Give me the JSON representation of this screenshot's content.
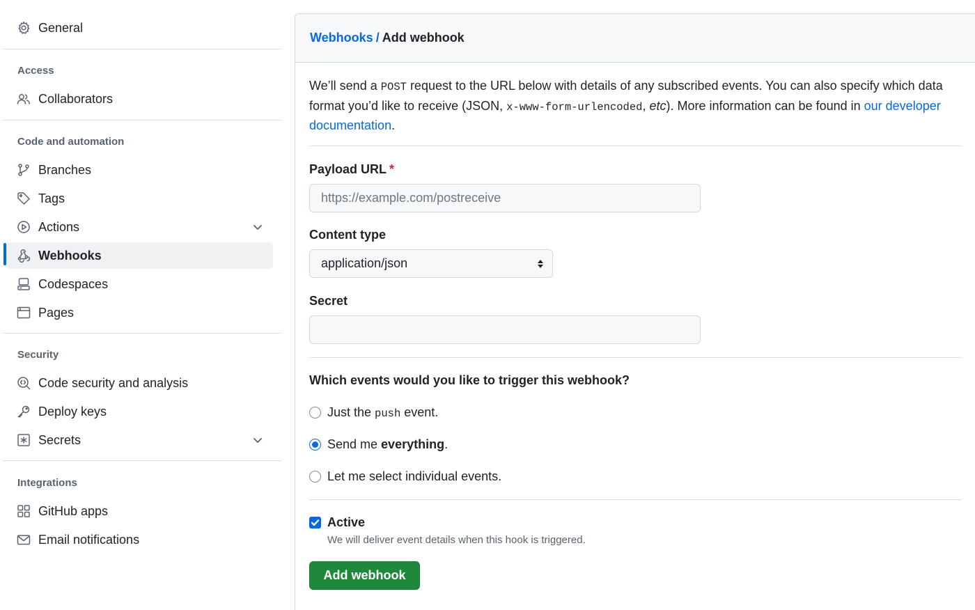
{
  "sidebar": {
    "general": {
      "label": "General",
      "icon": "gear-icon"
    },
    "sections": {
      "access": "Access",
      "code_automation": "Code and automation",
      "security": "Security",
      "integrations": "Integrations"
    },
    "items": {
      "collaborators": {
        "label": "Collaborators",
        "icon": "people-icon"
      },
      "branches": {
        "label": "Branches",
        "icon": "git-branch-icon"
      },
      "tags": {
        "label": "Tags",
        "icon": "tag-icon"
      },
      "actions": {
        "label": "Actions",
        "icon": "play-icon",
        "expandable": true
      },
      "webhooks": {
        "label": "Webhooks",
        "icon": "webhook-icon",
        "selected": true
      },
      "codespaces": {
        "label": "Codespaces",
        "icon": "codespaces-icon"
      },
      "pages": {
        "label": "Pages",
        "icon": "browser-icon"
      },
      "code_security": {
        "label": "Code security and analysis",
        "icon": "codescan-icon"
      },
      "deploy_keys": {
        "label": "Deploy keys",
        "icon": "key-icon"
      },
      "secrets": {
        "label": "Secrets",
        "icon": "key-asterisk-icon",
        "expandable": true
      },
      "github_apps": {
        "label": "GitHub apps",
        "icon": "apps-icon"
      },
      "email_notifications": {
        "label": "Email notifications",
        "icon": "mail-icon"
      }
    }
  },
  "breadcrumb": {
    "parent": "Webhooks",
    "separator": "/",
    "current": "Add webhook"
  },
  "intro": {
    "p1": "We’ll send a ",
    "code1": "POST",
    "p2": " request to the URL below with details of any subscribed events. You can also specify which data format you’d like to receive (JSON, ",
    "code2": "x-www-form-urlencoded",
    "p3": ", ",
    "em": "etc",
    "p4": "). More information can be found in ",
    "link": "our developer documentation",
    "p5": "."
  },
  "form": {
    "payload_url": {
      "label": "Payload URL",
      "required_mark": "*",
      "placeholder": "https://example.com/postreceive",
      "value": ""
    },
    "content_type": {
      "label": "Content type",
      "value": "application/json"
    },
    "secret": {
      "label": "Secret",
      "value": ""
    },
    "events": {
      "question": "Which events would you like to trigger this webhook?",
      "options": [
        {
          "pre": "Just the ",
          "code": "push",
          "post": " event.",
          "checked": false
        },
        {
          "pre": "Send me ",
          "bold": "everything",
          "post": ".",
          "checked": true
        },
        {
          "pre": "Let me select individual events.",
          "checked": false
        }
      ]
    },
    "active": {
      "label": "Active",
      "note": "We will deliver event details when this hook is triggered.",
      "checked": true
    },
    "submit_label": "Add webhook"
  },
  "colors": {
    "accent": "#0969da",
    "primary_button": "#1f883d",
    "required": "#d1242f"
  }
}
